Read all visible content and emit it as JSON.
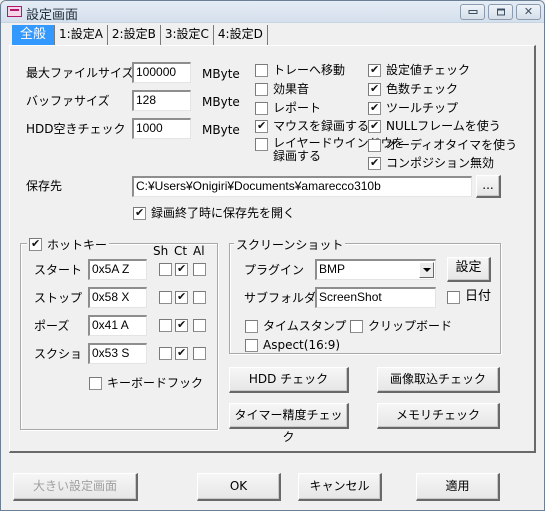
{
  "window": {
    "title": "設定画面",
    "controls": {
      "minimize": "minimize",
      "maximize": "maximize",
      "close": "✕"
    }
  },
  "tabs": [
    {
      "label": "全般",
      "active": true
    },
    {
      "label": "1:設定A",
      "active": false
    },
    {
      "label": "2:設定B",
      "active": false
    },
    {
      "label": "3:設定C",
      "active": false
    },
    {
      "label": "4:設定D",
      "active": false
    }
  ],
  "general": {
    "fields": [
      {
        "label": "最大ファイルサイズ",
        "value": "100000",
        "unit": "MByte"
      },
      {
        "label": "バッファサイズ",
        "value": "128",
        "unit": "MByte"
      },
      {
        "label": "HDD空きチェック",
        "value": "1000",
        "unit": "MByte"
      }
    ],
    "options_middle": [
      {
        "label": "トレーへ移動",
        "checked": false
      },
      {
        "label": "効果音",
        "checked": false
      },
      {
        "label": "レポート",
        "checked": false
      },
      {
        "label": "マウスを録画する",
        "checked": true
      },
      {
        "label": "レイヤードウインドウを\n録画する",
        "line1": "レイヤードウインドウを",
        "line2": "録画する",
        "checked": false
      }
    ],
    "options_right": [
      {
        "label": "設定値チェック",
        "checked": true
      },
      {
        "label": "色数チェック",
        "checked": true
      },
      {
        "label": "ツールチップ",
        "checked": true
      },
      {
        "label": "NULLフレームを使う",
        "checked": true
      },
      {
        "label": "オーディオタイマを使う",
        "checked": false
      },
      {
        "label": "コンポジション無効",
        "checked": true
      }
    ],
    "save_dir": {
      "label": "保存先",
      "value": "C:¥Users¥Onigiri¥Documents¥amarecco310b",
      "browse_label": "...",
      "open_on_finish": {
        "label": "録画終了時に保存先を開く",
        "checked": true
      }
    }
  },
  "hotkey": {
    "label": "ホットキー",
    "enabled": true,
    "columns": [
      "Sh",
      "Ct",
      "Al"
    ],
    "rows": [
      {
        "label": "スタート",
        "value": "0x5A Z",
        "sh": false,
        "ct": true,
        "al": false
      },
      {
        "label": "ストップ",
        "value": "0x58 X",
        "sh": false,
        "ct": true,
        "al": false
      },
      {
        "label": "ポーズ",
        "value": "0x41 A",
        "sh": false,
        "ct": true,
        "al": false
      },
      {
        "label": "スクショ",
        "value": "0x53 S",
        "sh": false,
        "ct": true,
        "al": false
      }
    ],
    "keyboard_hook": {
      "label": "キーボードフック",
      "checked": false
    }
  },
  "screenshot": {
    "label": "スクリーンショット",
    "plugin_label": "プラグイン",
    "plugin_value": "BMP",
    "settings_button": "設定",
    "subfolder_label": "サブフォルダ",
    "subfolder_value": "ScreenShot",
    "date": {
      "label": "日付",
      "checked": false
    },
    "timestamp": {
      "label": "タイムスタンプ",
      "checked": false
    },
    "clipboard": {
      "label": "クリップボード",
      "checked": false
    },
    "aspect": {
      "label": "Aspect(16:9)",
      "checked": false
    }
  },
  "check_buttons": {
    "hdd": "HDD チェック",
    "image_capture": "画像取込チェック",
    "timer": "タイマー精度チェック",
    "memory": "メモリチェック"
  },
  "footer": {
    "large_settings": "大きい設定画面",
    "ok": "OK",
    "cancel": "キャンセル",
    "apply": "適用"
  }
}
